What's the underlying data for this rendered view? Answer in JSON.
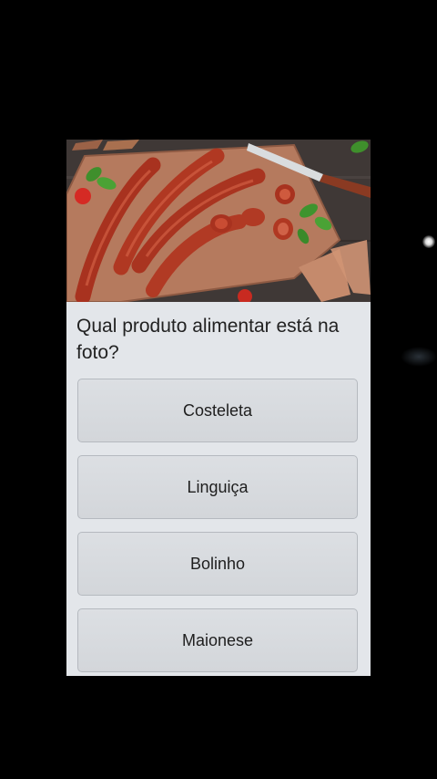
{
  "quiz": {
    "question": "Qual produto alimentar está na foto?",
    "answers": [
      {
        "label": "Costeleta"
      },
      {
        "label": "Linguiça"
      },
      {
        "label": "Bolinho"
      },
      {
        "label": "Maionese"
      }
    ]
  },
  "photo": {
    "subject": "sausages-on-cutting-board-image"
  },
  "colors": {
    "background": "#000000",
    "card": "#e3e6ea",
    "answer_button": "#d7dade",
    "answer_border": "#b5b9bf",
    "text": "#222222"
  }
}
